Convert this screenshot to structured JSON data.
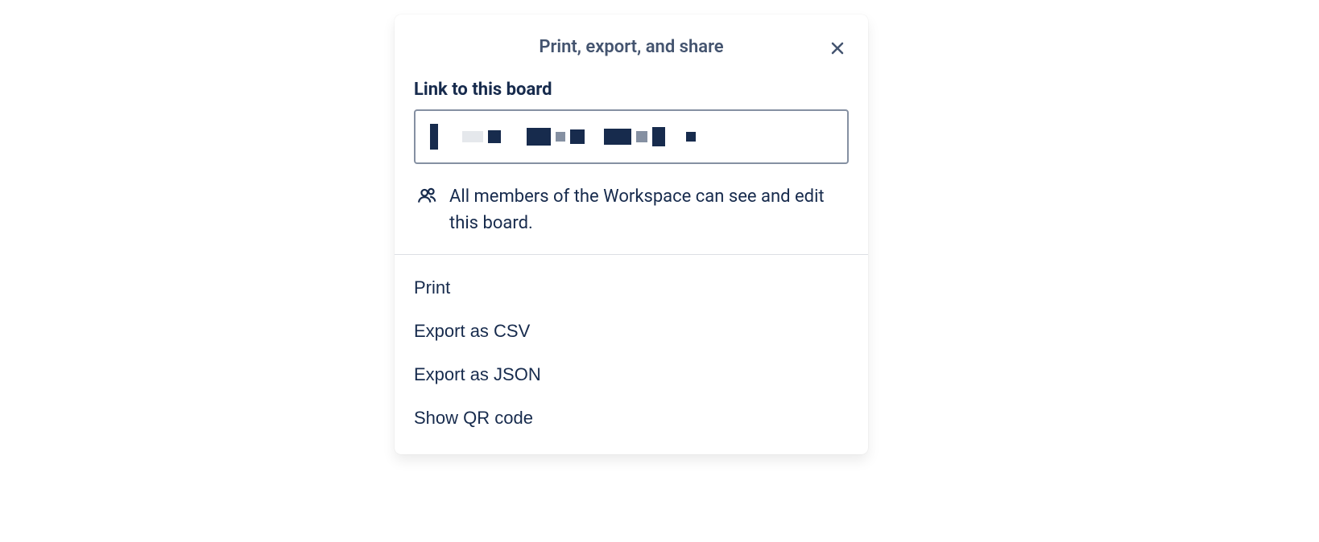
{
  "modal": {
    "title": "Print, export, and share",
    "link_section_label": "Link to this board",
    "info_text": "All members of the Workspace can see and edit this board.",
    "actions": {
      "print": "Print",
      "export_csv": "Export as CSV",
      "export_json": "Export as JSON",
      "qr_code": "Show QR code"
    }
  }
}
